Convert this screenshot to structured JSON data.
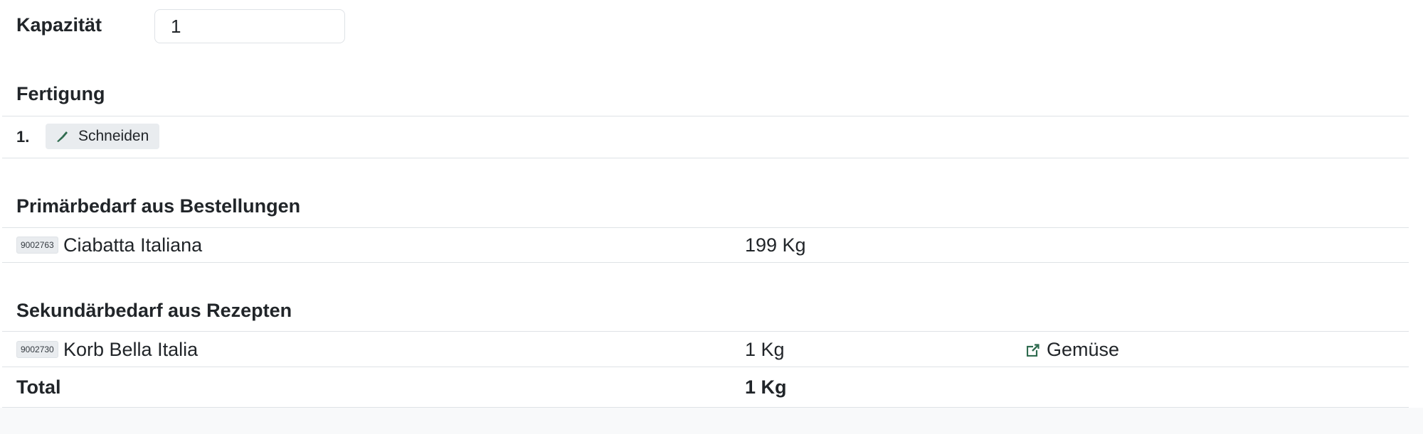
{
  "capacity": {
    "label": "Kapazität",
    "value": "1"
  },
  "production": {
    "title": "Fertigung",
    "steps": [
      {
        "number": "1.",
        "label": "Schneiden",
        "icon": "knife-icon"
      }
    ]
  },
  "primary_demand": {
    "title": "Primärbedarf aus Bestellungen",
    "rows": [
      {
        "code": "9002763",
        "name": "Ciabatta Italiana",
        "quantity": "199 Kg"
      }
    ]
  },
  "secondary_demand": {
    "title": "Sekundärbedarf aus Rezepten",
    "rows": [
      {
        "code": "9002730",
        "name": "Korb Bella Italia",
        "quantity": "1 Kg",
        "recipe": "Gemüse",
        "recipe_icon": "external-link-icon"
      }
    ],
    "total": {
      "label": "Total",
      "quantity": "1 Kg"
    }
  },
  "colors": {
    "accent": "#2f6b4f",
    "border": "#dee2e6",
    "chip_bg": "#e9ecef"
  }
}
